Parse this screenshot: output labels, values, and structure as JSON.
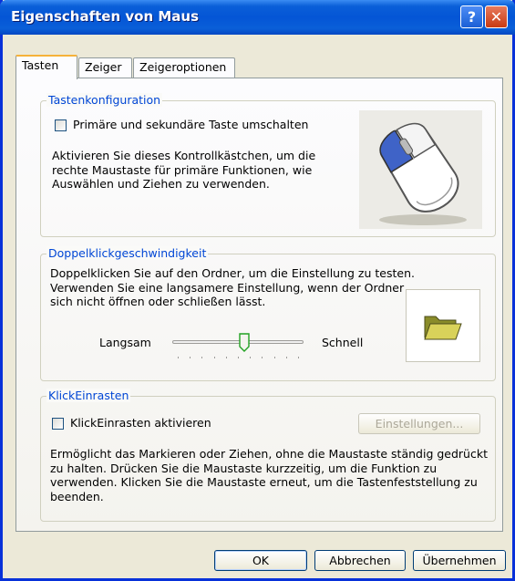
{
  "window": {
    "title": "Eigenschaften von Maus"
  },
  "titlebar": {
    "help_glyph": "?",
    "close_glyph": "✕"
  },
  "tabs": [
    {
      "label": "Tasten",
      "active": true
    },
    {
      "label": "Zeiger",
      "active": false
    },
    {
      "label": "Zeigeroptionen",
      "active": false
    }
  ],
  "button_config": {
    "legend": "Tastenkonfiguration",
    "checkbox_label": "Primäre und sekundäre Taste umschalten",
    "checked": false,
    "description": "Aktivieren Sie dieses Kontrollkästchen, um die rechte Maustaste für primäre Funktionen, wie Auswählen und Ziehen zu verwenden.",
    "image_icon": "mouse-icon"
  },
  "double_click": {
    "legend": "Doppelklickgeschwindigkeit",
    "description": "Doppelklicken Sie auf den Ordner, um die Einstellung zu testen. Verwenden Sie eine langsamere Einstellung, wenn der Ordner sich nicht öffnen oder schließen lässt.",
    "slow_label": "Langsam",
    "fast_label": "Schnell",
    "speed_fraction": 0.55,
    "test_icon": "folder-icon"
  },
  "click_lock": {
    "legend": "KlickEinrasten",
    "checkbox_label": "KlickEinrasten aktivieren",
    "checked": false,
    "settings_button": "Einstellungen...",
    "description": "Ermöglicht das Markieren oder Ziehen, ohne die Maustaste ständig gedrückt zu halten. Drücken Sie die Maustaste kurzzeitig, um die Funktion zu verwenden. Klicken Sie die Maustaste erneut, um die Tastenfeststellung zu beenden."
  },
  "footer": {
    "ok": "OK",
    "cancel": "Abbrechen",
    "apply": "Übernehmen"
  },
  "colors": {
    "accent": "#0046d5",
    "titlebar": "#0455d6",
    "face": "#ece9d8"
  }
}
